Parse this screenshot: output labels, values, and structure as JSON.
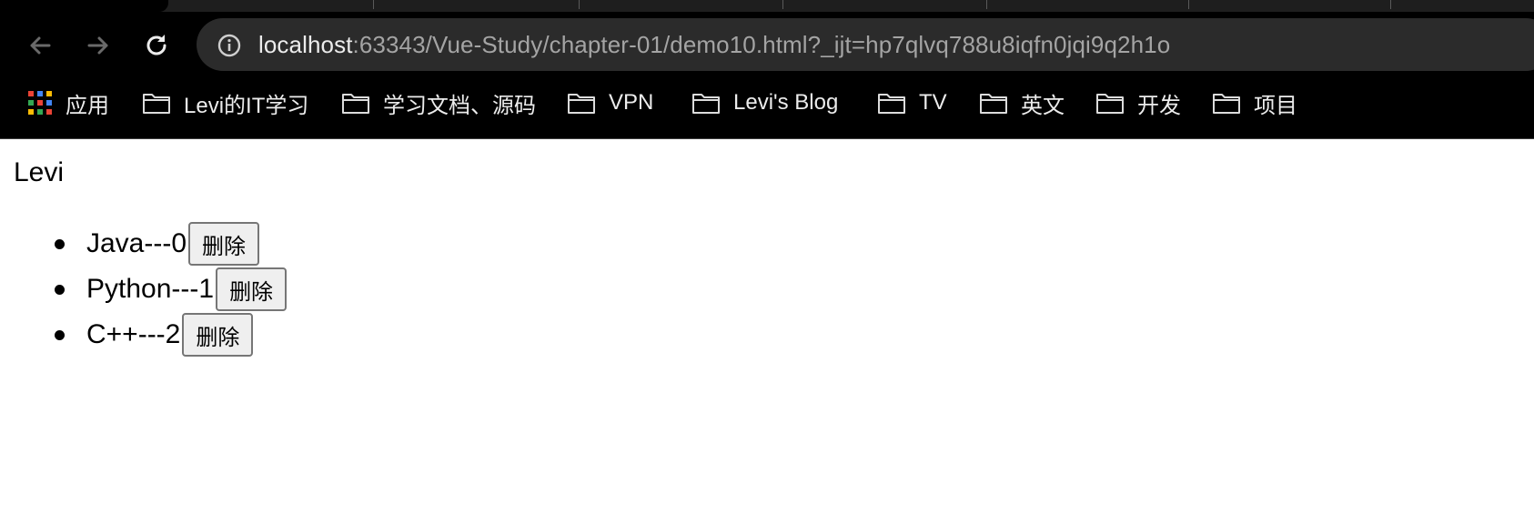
{
  "browser": {
    "url_host": "localhost",
    "url_rest": ":63343/Vue-Study/chapter-01/demo10.html?_ijt=hp7qlvq788u8iqfn0jqi9q2h1o",
    "bookmarks": [
      {
        "label": "应用",
        "icon": "apps-grid-icon"
      },
      {
        "label": "Levi的IT学习",
        "icon": "folder-icon"
      },
      {
        "label": "学习文档、源码",
        "icon": "folder-icon"
      },
      {
        "label": "VPN",
        "icon": "folder-icon"
      },
      {
        "label": "Levi's Blog",
        "icon": "folder-icon"
      },
      {
        "label": "TV",
        "icon": "folder-icon"
      },
      {
        "label": "英文",
        "icon": "folder-icon"
      },
      {
        "label": "开发",
        "icon": "folder-icon"
      },
      {
        "label": "项目",
        "icon": "folder-icon"
      }
    ]
  },
  "page": {
    "name": "Levi",
    "items": [
      {
        "text": "Java---0",
        "button": "删除"
      },
      {
        "text": "Python---1",
        "button": "删除"
      },
      {
        "text": "C++---2",
        "button": "删除"
      }
    ]
  },
  "colors": {
    "chrome_bg": "#000000",
    "omnibox_bg": "#2b2b2b",
    "url_host": "#ececec",
    "url_rest": "#a4a4a4",
    "button_bg": "#efefef"
  }
}
